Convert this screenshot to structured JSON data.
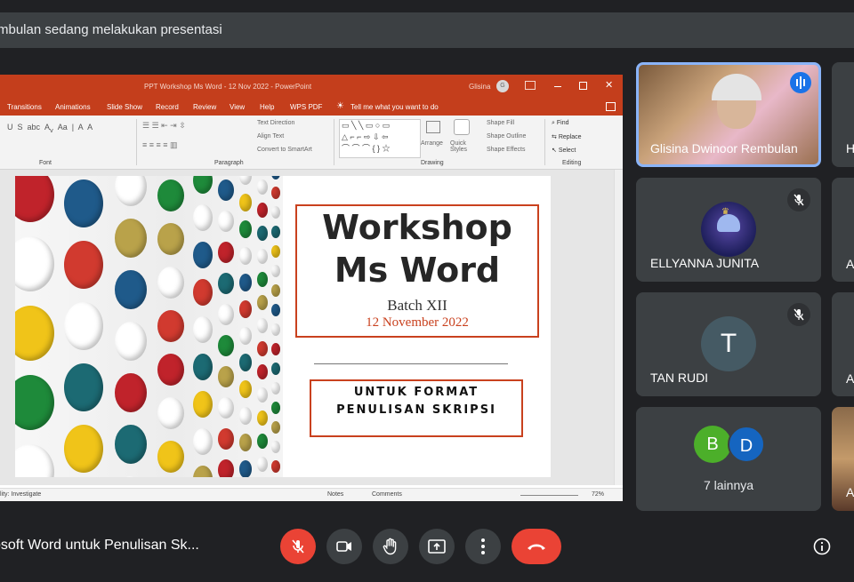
{
  "banner": {
    "text": "mbulan sedang melakukan presentasi"
  },
  "powerpoint": {
    "title": "PPT Workshop Ms Word - 12 Nov 2022 - PowerPoint",
    "user": "Glisina",
    "user_initial": "G",
    "tabs": [
      "Transitions",
      "Animations",
      "Slide Show",
      "Record",
      "Review",
      "View",
      "Help",
      "WPS PDF"
    ],
    "tell_me": "Tell me what you want to do",
    "groups": [
      "Font",
      "Paragraph",
      "Drawing",
      "Editing"
    ],
    "paragraph_cmds": [
      "Text Direction",
      "Align Text",
      "Convert to SmartArt"
    ],
    "drawing_cmds": [
      "Arrange",
      "Quick Styles",
      "Shape Fill",
      "Shape Outline",
      "Shape Effects"
    ],
    "editing_cmds": [
      "Find",
      "Replace",
      "Select"
    ],
    "status": {
      "accessibility": "lity: Investigate",
      "notes": "Notes",
      "comments": "Comments",
      "zoom": "72%"
    }
  },
  "slide": {
    "title_line1": "Workshop",
    "title_line2": "Ms Word",
    "batch": "Batch XII",
    "date": "12 November 2022",
    "sub_line1": "UNTUK FORMAT",
    "sub_line2": "PENULISAN SKRIPSI"
  },
  "participants": {
    "speaker": {
      "name": "Glisina Dwinoor Rembulan"
    },
    "p2": {
      "name": "ELLYANNA JUNITA"
    },
    "p3": {
      "name": "TAN RUDI",
      "initial": "T"
    },
    "others": {
      "label": "7 lainnya",
      "initial_b": "B",
      "initial_d": "D"
    },
    "right_initials": [
      "H",
      "A",
      "A",
      "A"
    ]
  },
  "meeting": {
    "title": "osoft Word untuk Penulisan Sk..."
  },
  "colors": {
    "end_call": "#ea4335",
    "mic_off": "#ea4335",
    "speaking": "#8ab4f8",
    "powerpoint": "#c43e1c"
  }
}
